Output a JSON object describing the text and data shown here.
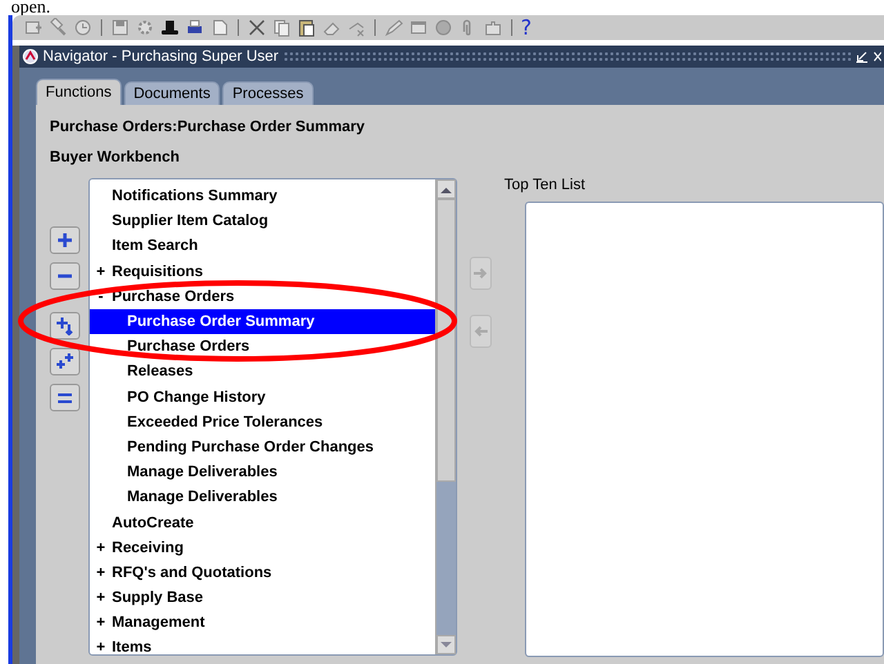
{
  "page_text": "open.",
  "toolbar": {
    "help": "?"
  },
  "window": {
    "title": "Navigator - Purchasing Super User"
  },
  "tabs": [
    {
      "label": "Functions",
      "selected": true
    },
    {
      "label": "Documents",
      "selected": false
    },
    {
      "label": "Processes",
      "selected": false
    }
  ],
  "path": "Purchase Orders:Purchase Order Summary",
  "responsibility": "Buyer Workbench",
  "tree": [
    {
      "label": "Notifications Summary",
      "selected": false
    },
    {
      "label": "Supplier Item Catalog",
      "selected": false
    },
    {
      "label": "Item Search",
      "selected": false
    },
    {
      "label": "Requisitions",
      "toggle": "+",
      "expanded": false,
      "selected": false
    },
    {
      "label": "Purchase Orders",
      "toggle": "-",
      "expanded": true,
      "selected": false,
      "children": [
        {
          "label": "Purchase Order Summary",
          "selected": true
        },
        {
          "label": "Purchase Orders",
          "selected": false
        },
        {
          "label": "Releases",
          "selected": false
        },
        {
          "label": "PO Change History",
          "selected": false
        },
        {
          "label": "Exceeded Price Tolerances",
          "selected": false
        },
        {
          "label": "Pending Purchase Order Changes",
          "selected": false
        },
        {
          "label": "Manage Deliverables",
          "selected": false
        },
        {
          "label": "Manage Deliverables",
          "selected": false
        }
      ]
    },
    {
      "label": "AutoCreate",
      "selected": false
    },
    {
      "label": "Receiving",
      "toggle": "+",
      "expanded": false,
      "selected": false
    },
    {
      "label": "RFQ's and Quotations",
      "toggle": "+",
      "expanded": false,
      "selected": false
    },
    {
      "label": "Supply Base",
      "toggle": "+",
      "expanded": false,
      "selected": false
    },
    {
      "label": "Management",
      "toggle": "+",
      "expanded": false,
      "selected": false
    },
    {
      "label": "Items",
      "toggle": "+",
      "expanded": false,
      "selected": false
    }
  ],
  "top_ten": {
    "label": "Top Ten List"
  }
}
